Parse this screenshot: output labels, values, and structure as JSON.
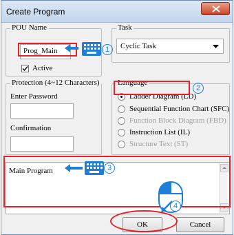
{
  "window": {
    "title": "Create Program"
  },
  "pou": {
    "group_label": "POU Name",
    "name_value": "Prog_Main",
    "active_label": "Active",
    "active_checked": true
  },
  "task": {
    "group_label": "Task",
    "selected": "Cyclic Task"
  },
  "protection": {
    "group_label": "Protection (4~12 Characters)",
    "password_label": "Enter Password",
    "password_value": "",
    "confirm_label": "Confirmation",
    "confirm_value": ""
  },
  "language": {
    "group_label": "Language",
    "options": [
      {
        "label": "Ladder Diagram (LD)",
        "selected": true,
        "enabled": true
      },
      {
        "label": "Sequential Function Chart (SFC)",
        "selected": false,
        "enabled": true
      },
      {
        "label": "Function Block Diagram (FBD)",
        "selected": false,
        "enabled": false
      },
      {
        "label": "Instruction List (IL)",
        "selected": false,
        "enabled": true
      },
      {
        "label": "Structure Text (ST)",
        "selected": false,
        "enabled": false
      }
    ]
  },
  "description": {
    "value": "Main Program"
  },
  "buttons": {
    "ok": "OK",
    "cancel": "Cancel"
  },
  "annotations": {
    "step1": "1",
    "step2": "2",
    "step3": "3",
    "step4": "4",
    "highlight_color": "#e8202a",
    "arrow_color": "#1f7fd8"
  }
}
